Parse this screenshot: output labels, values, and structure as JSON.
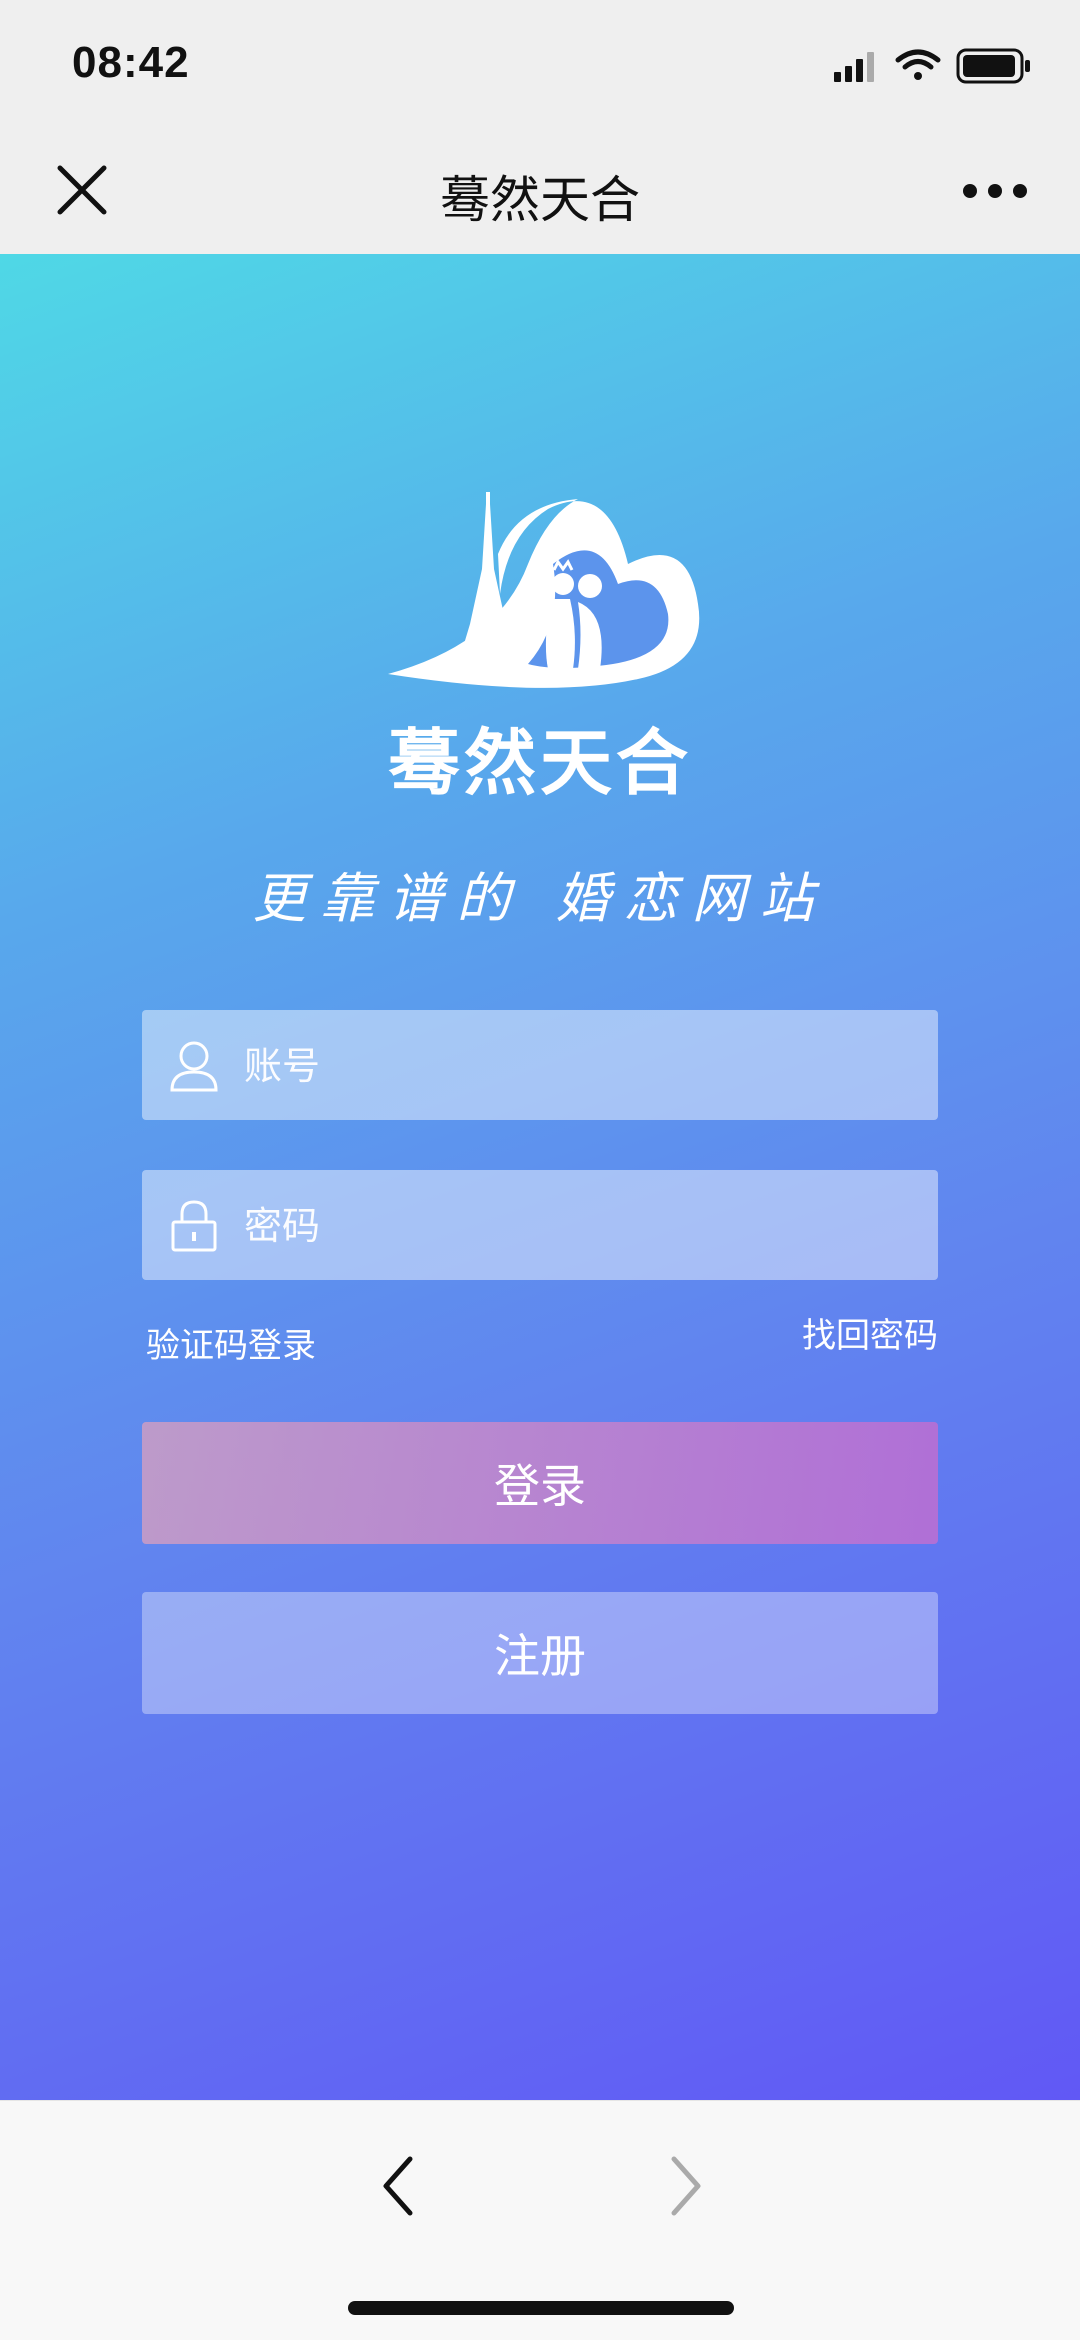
{
  "status": {
    "time": "08:42"
  },
  "nav": {
    "title": "蓦然天合"
  },
  "brand": {
    "logo_text": "蓦然天合",
    "slogan": "更靠谱的 婚恋网站"
  },
  "form": {
    "account_placeholder": "账号",
    "password_placeholder": "密码",
    "sms_login_label": "验证码登录",
    "forgot_password_label": "找回密码",
    "login_button": "登录",
    "register_button": "注册"
  },
  "colors": {
    "gradient_top": "#4fd8e6",
    "gradient_bottom": "#6158f5"
  }
}
